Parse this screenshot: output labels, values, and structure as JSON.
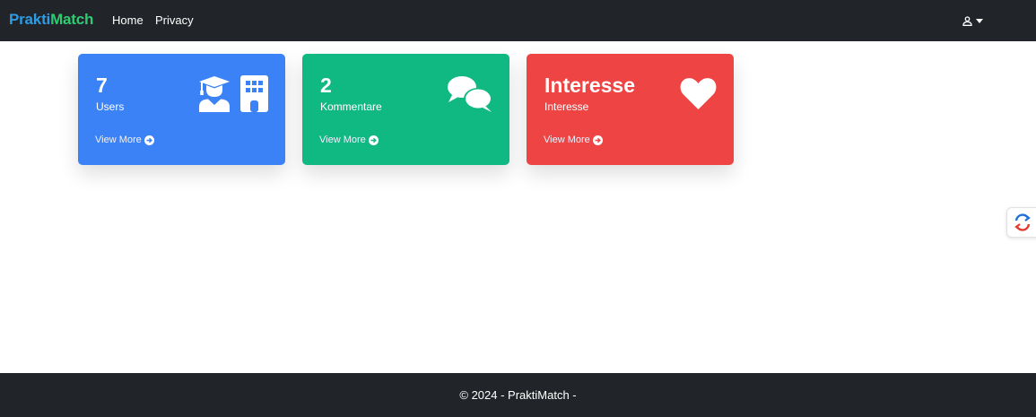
{
  "navbar": {
    "brand_part1": "Prakti",
    "brand_part2": "Match",
    "links": [
      "Home",
      "Privacy"
    ]
  },
  "cards": [
    {
      "value": "7",
      "label": "Users",
      "link": "View More",
      "color": "#3b82f6",
      "icons": [
        "user-graduate-icon",
        "building-icon"
      ]
    },
    {
      "value": "2",
      "label": "Kommentare",
      "link": "View More",
      "color": "#10b981",
      "icons": [
        "comments-icon"
      ]
    },
    {
      "value": "Interesse",
      "label": "Interesse",
      "link": "View More",
      "color": "#ef4444",
      "icons": [
        "heart-icon"
      ]
    }
  ],
  "footer": {
    "text": "© 2024 - PraktiMatch -"
  }
}
